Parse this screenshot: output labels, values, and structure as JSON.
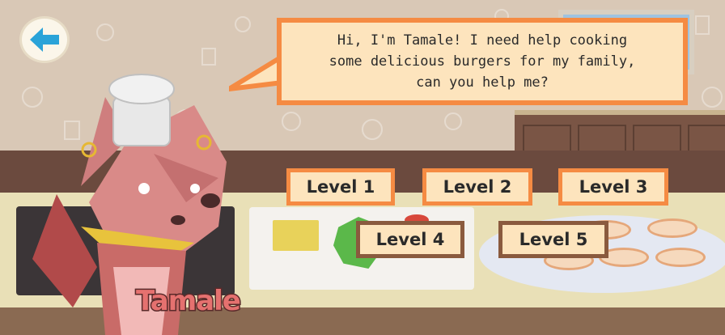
{
  "dialog": {
    "text": "Hi, I'm Tamale! I need help cooking\nsome delicious burgers for my family,\ncan you help me?"
  },
  "character": {
    "name": "Tamale"
  },
  "levels": [
    {
      "label": "Level 1"
    },
    {
      "label": "Level 2"
    },
    {
      "label": "Level 3"
    },
    {
      "label": "Level 4"
    },
    {
      "label": "Level 5"
    }
  ],
  "colors": {
    "bubble_border": "#f58b43",
    "bubble_fill": "#fde4bd",
    "level_border_alt": "#8a5a3e",
    "back_arrow": "#2aa3d8",
    "name_fill": "#e5716f"
  },
  "icons": {
    "back": "back-arrow-icon"
  }
}
